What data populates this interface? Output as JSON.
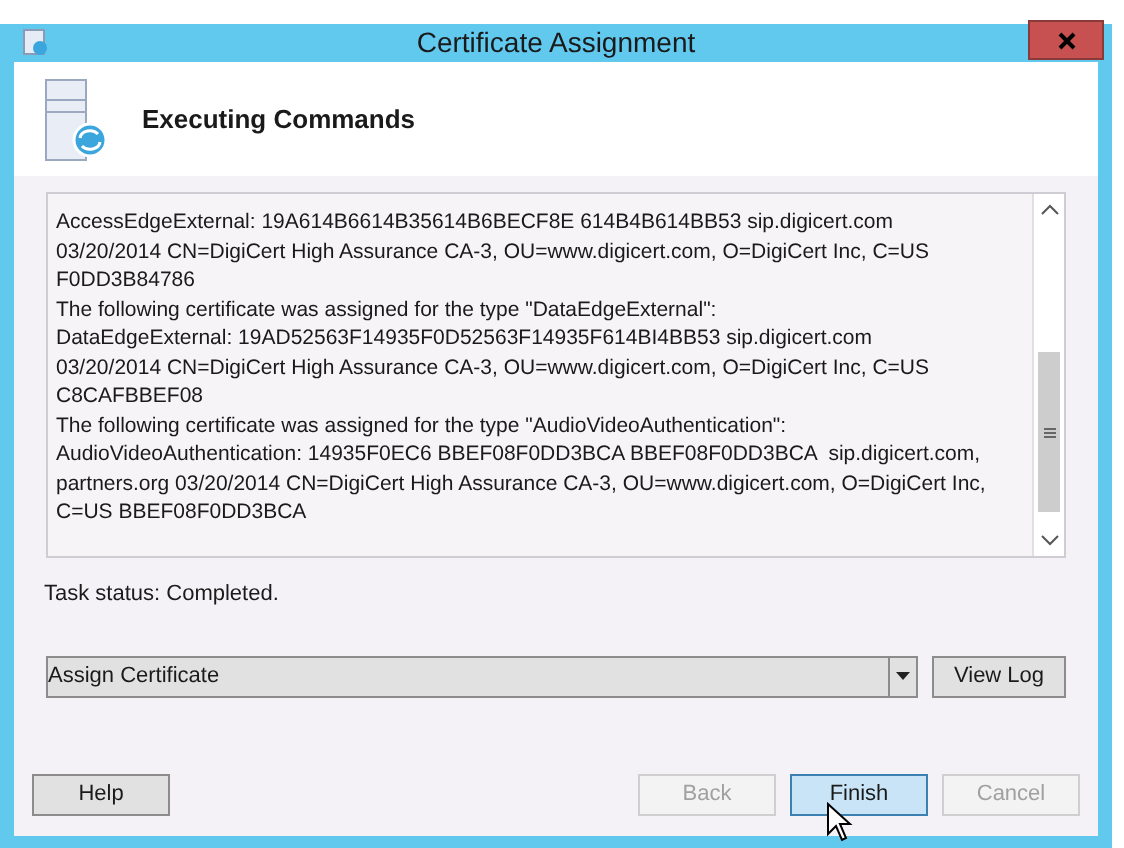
{
  "window": {
    "title": "Certificate Assignment"
  },
  "header": {
    "title": "Executing Commands"
  },
  "log": {
    "lines": [
      "AccessEdgeExternal: 19A614B6614B35614B6BECF8E 614B4B614BB53 sip.digicert.com",
      "03/20/2014 CN=DigiCert High Assurance CA-3, OU=www.digicert.com, O=DigiCert Inc, C=US",
      "F0DD3B84786",
      "The following certificate was assigned for the type \"DataEdgeExternal\":",
      "DataEdgeExternal: 19AD52563F14935F0D52563F14935F614BI4BB53 sip.digicert.com",
      "03/20/2014 CN=DigiCert High Assurance CA-3, OU=www.digicert.com, O=DigiCert Inc, C=US",
      "C8CAFBBEF08",
      "The following certificate was assigned for the type \"AudioVideoAuthentication\":",
      "AudioVideoAuthentication: 14935F0EC6 BBEF08F0DD3BCA BBEF08F0DD3BCA  sip.digicert.com,",
      "partners.org 03/20/2014 CN=DigiCert High Assurance CA-3, OU=www.digicert.com, O=DigiCert Inc,",
      "C=US BBEF08F0DD3BCA"
    ]
  },
  "task_status": "Task status: Completed.",
  "task_select": {
    "value": "Assign Certificate"
  },
  "view_log_button": "View Log",
  "buttons": [
    {
      "label": "Help",
      "disabled": false,
      "hovered": false
    },
    {
      "label": "Back",
      "disabled": true,
      "hovered": false
    },
    {
      "label": "Finish",
      "disabled": false,
      "hovered": true
    },
    {
      "label": "Cancel",
      "disabled": true,
      "hovered": false
    }
  ]
}
